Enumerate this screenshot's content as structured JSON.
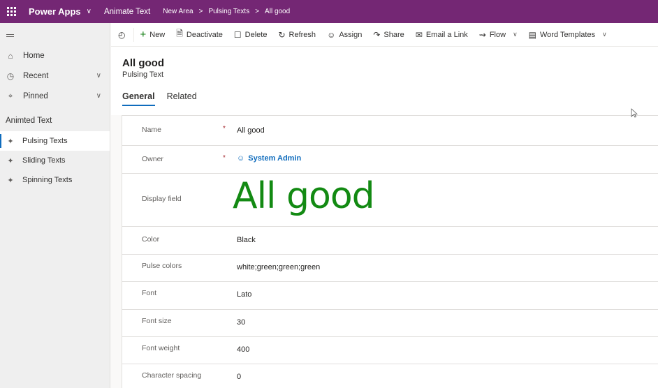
{
  "topbar": {
    "app_name": "Power Apps",
    "app_title": "Animate Text",
    "breadcrumbs": [
      "New Area",
      "Pulsing Texts",
      "All good"
    ]
  },
  "sidebar": {
    "items": [
      {
        "label": "Home",
        "icon": "home-icon"
      },
      {
        "label": "Recent",
        "icon": "clock-icon"
      },
      {
        "label": "Pinned",
        "icon": "pin-icon"
      }
    ],
    "group_title": "Animted Text",
    "sub_items": [
      {
        "label": "Pulsing Texts",
        "icon": "puzzle-icon",
        "active": true
      },
      {
        "label": "Sliding Texts",
        "icon": "puzzle-icon"
      },
      {
        "label": "Spinning Texts",
        "icon": "puzzle-icon"
      }
    ]
  },
  "commands": {
    "new": "New",
    "deactivate": "Deactivate",
    "delete": "Delete",
    "refresh": "Refresh",
    "assign": "Assign",
    "share": "Share",
    "email_link": "Email a Link",
    "flow": "Flow",
    "word_templates": "Word Templates"
  },
  "record": {
    "title": "All good",
    "subtitle": "Pulsing Text",
    "tabs": [
      "General",
      "Related"
    ],
    "active_tab": "General"
  },
  "fields": {
    "name": {
      "label": "Name",
      "value": "All good",
      "required": "*"
    },
    "owner": {
      "label": "Owner",
      "value": "System Admin",
      "required": "*"
    },
    "display": {
      "label": "Display field",
      "value": "All good"
    },
    "color": {
      "label": "Color",
      "value": "Black"
    },
    "pulse": {
      "label": "Pulse colors",
      "value": "white;green;green;green"
    },
    "font": {
      "label": "Font",
      "value": "Lato"
    },
    "font_size": {
      "label": "Font size",
      "value": "30"
    },
    "font_weight": {
      "label": "Font weight",
      "value": "400"
    },
    "char_spacing": {
      "label": "Character spacing",
      "value": "0"
    }
  },
  "colors": {
    "topbar": "#742774",
    "accent": "#0f6cbd",
    "display_text": "#138a13"
  }
}
